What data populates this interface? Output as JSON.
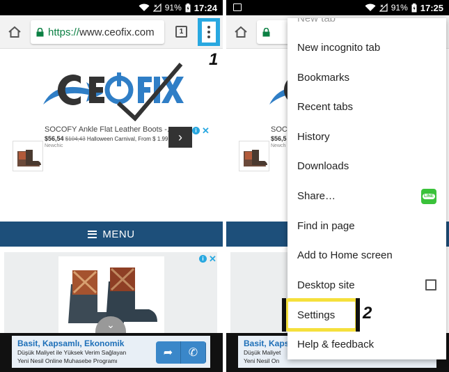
{
  "left": {
    "status": {
      "battery": "91%",
      "time": "17:24"
    },
    "browser": {
      "url_scheme": "https://",
      "url_host": "www.ceofix.com",
      "tab_count": "1"
    },
    "step_label": "1",
    "ad": {
      "title": "SOCOFY Ankle Flat Leather Boots -...",
      "price": "$56,54",
      "old_price": "$104,43",
      "price_note": "Halloween Carnival, From $ 1.99",
      "source": "Newchic"
    },
    "menu_bar_label": "MENU",
    "banner": {
      "headline": "Basit, Kapsamlı, Ekonomik",
      "line1": "Düşük Maliyet ile Yüksek Verim Sağlayan",
      "line2": "Yeni Nesil Online Muhasebe Programı"
    }
  },
  "right": {
    "status": {
      "battery": "91%",
      "time": "17:25"
    },
    "menu_items": [
      "New tab",
      "New incognito tab",
      "Bookmarks",
      "Recent tabs",
      "History",
      "Downloads",
      "Share…",
      "Find in page",
      "Add to Home screen",
      "Desktop site",
      "Settings",
      "Help & feedback"
    ],
    "step_label": "2",
    "banner_headline_partial": "Basit, Kapsa",
    "banner_line1_partial": "Düşük Maliyet",
    "banner_line2_partial": "Yeni Nesil On",
    "ad_title_partial": "SOCO",
    "ad_price_partial": "$56,5",
    "ad_source_partial": "Newch",
    "line_badge": "LINE"
  },
  "colors": {
    "accent_blue": "#29a8e0",
    "highlight_yellow": "#f5e03c",
    "nav_bar": "#1d4f7a",
    "secure_green": "#0b8043"
  },
  "icons": [
    "wifi-icon",
    "signal-icon",
    "battery-icon",
    "home-icon",
    "lock-icon",
    "tabs-icon",
    "more-vert-icon",
    "adchoices-icon",
    "close-icon",
    "chevron-right-icon",
    "hamburger-icon",
    "chevron-up-icon",
    "share-arrow-icon",
    "phone-icon",
    "line-app-icon",
    "checkbox-icon",
    "image-icon"
  ]
}
